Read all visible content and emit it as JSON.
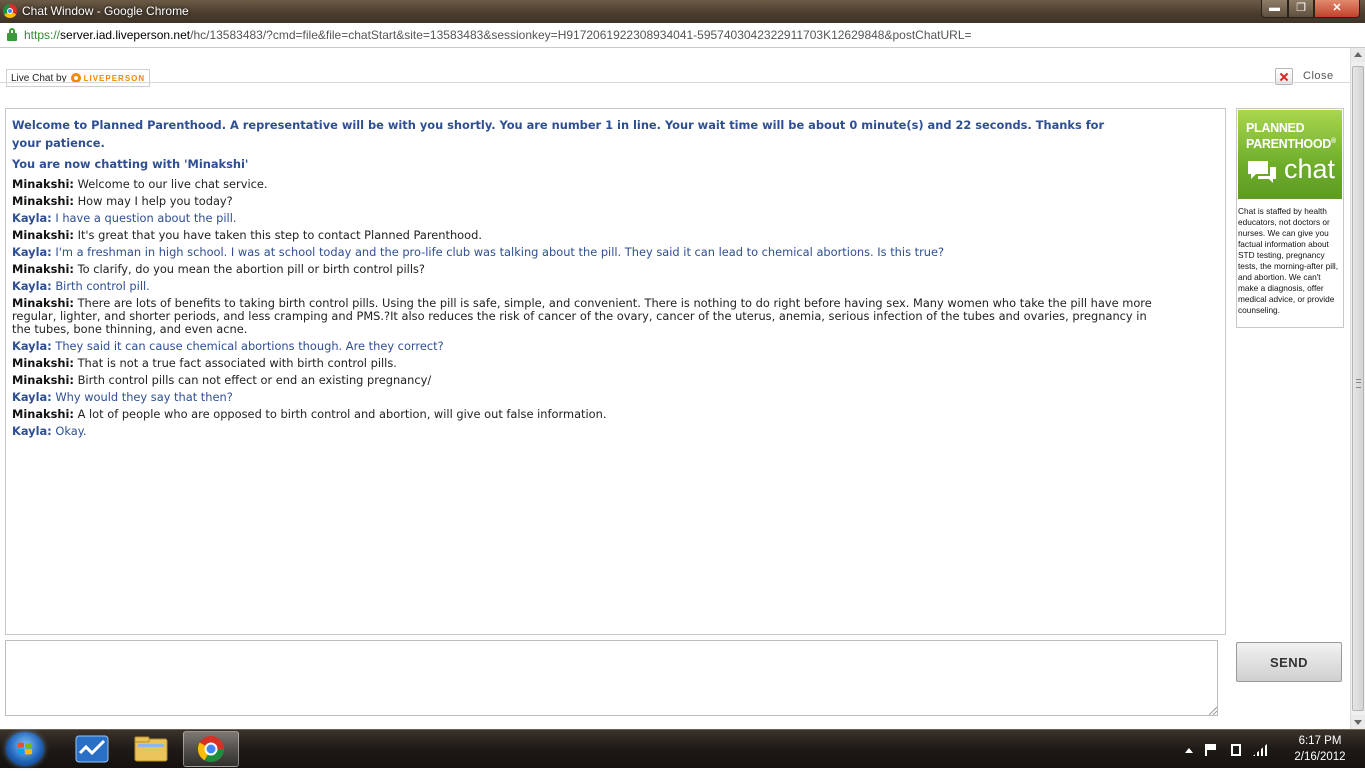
{
  "window": {
    "title": "Chat Window - Google Chrome",
    "minimize_glyph": "▬",
    "maximize_glyph": "❐",
    "close_glyph": "✕"
  },
  "urlbar": {
    "scheme": "https://",
    "host": "server.iad.liveperson.net",
    "path": "/hc/13583483/?cmd=file&file=chatStart&site=13583483&sessionkey=H9172061922308934041-5957403042322911703K12629848&postChatURL="
  },
  "header": {
    "brand_prefix": "Live Chat by",
    "brand_name": "LIVEPERSON",
    "close_label": "Close"
  },
  "transcript": {
    "welcome": "Welcome to Planned Parenthood. A representative will be with you shortly. You are number 1 in line. Your wait time will be about 0 minute(s) and 22 seconds. Thanks for your patience.",
    "now_chatting": "You are now chatting with 'Minakshi'",
    "messages": [
      {
        "who": "Minakshi:",
        "text": "Welcome to our live chat service."
      },
      {
        "who": "Minakshi:",
        "text": "How may I help you today?"
      },
      {
        "who": "Kayla:",
        "text": "I have a question about the pill."
      },
      {
        "who": "Minakshi:",
        "text": "It's great that you have taken this step to contact Planned Parenthood."
      },
      {
        "who": "Kayla:",
        "text": "I'm a freshman in high school. I was at school today and the pro-life club was talking about the pill. They said it can lead to chemical abortions. Is this true?"
      },
      {
        "who": "Minakshi:",
        "text": "To clarify, do you mean the abortion pill or birth control pills?"
      },
      {
        "who": "Kayla:",
        "text": "Birth control pill."
      },
      {
        "who": "Minakshi:",
        "text": "There are lots of benefits to taking birth control pills. Using the pill is safe, simple, and convenient. There is nothing to do right before having sex. Many women who take the pill have more regular, lighter, and shorter periods, and less cramping and PMS.?It also reduces the risk of cancer of the ovary, cancer of the uterus, anemia, serious infection of the tubes and ovaries, pregnancy in the tubes, bone thinning, and even acne."
      },
      {
        "who": "Kayla:",
        "text": "They said it can cause chemical abortions though. Are they correct?"
      },
      {
        "who": "Minakshi:",
        "text": "That is not a true fact associated with birth control pills."
      },
      {
        "who": "Minakshi:",
        "text": "Birth control pills can not effect or end an existing pregnancy/"
      },
      {
        "who": "Kayla:",
        "text": "Why would they say that then?"
      },
      {
        "who": "Minakshi:",
        "text": "A lot of people who are opposed to birth control and abortion, will give out false information."
      },
      {
        "who": "Kayla:",
        "text": "Okay."
      }
    ]
  },
  "side_panel": {
    "logo_line1": "PLANNED",
    "logo_line2": "PARENTHOOD",
    "logo_reg": "®",
    "logo_chat": "chat",
    "description": "Chat is staffed by health educators, not doctors or nurses. We can give you factual information about STD testing, pregnancy tests, the morning-after pill, and abortion. We can't make a diagnosis, offer medical advice, or provide counseling."
  },
  "composer": {
    "input_value": "",
    "send_label": "SEND"
  },
  "taskbar": {
    "clock_time": "6:17 PM",
    "clock_date": "2/16/2012"
  },
  "colors": {
    "visitor_text": "#2f4f92",
    "brand_orange": "#f08a00",
    "pp_green": "#6fae2c"
  }
}
